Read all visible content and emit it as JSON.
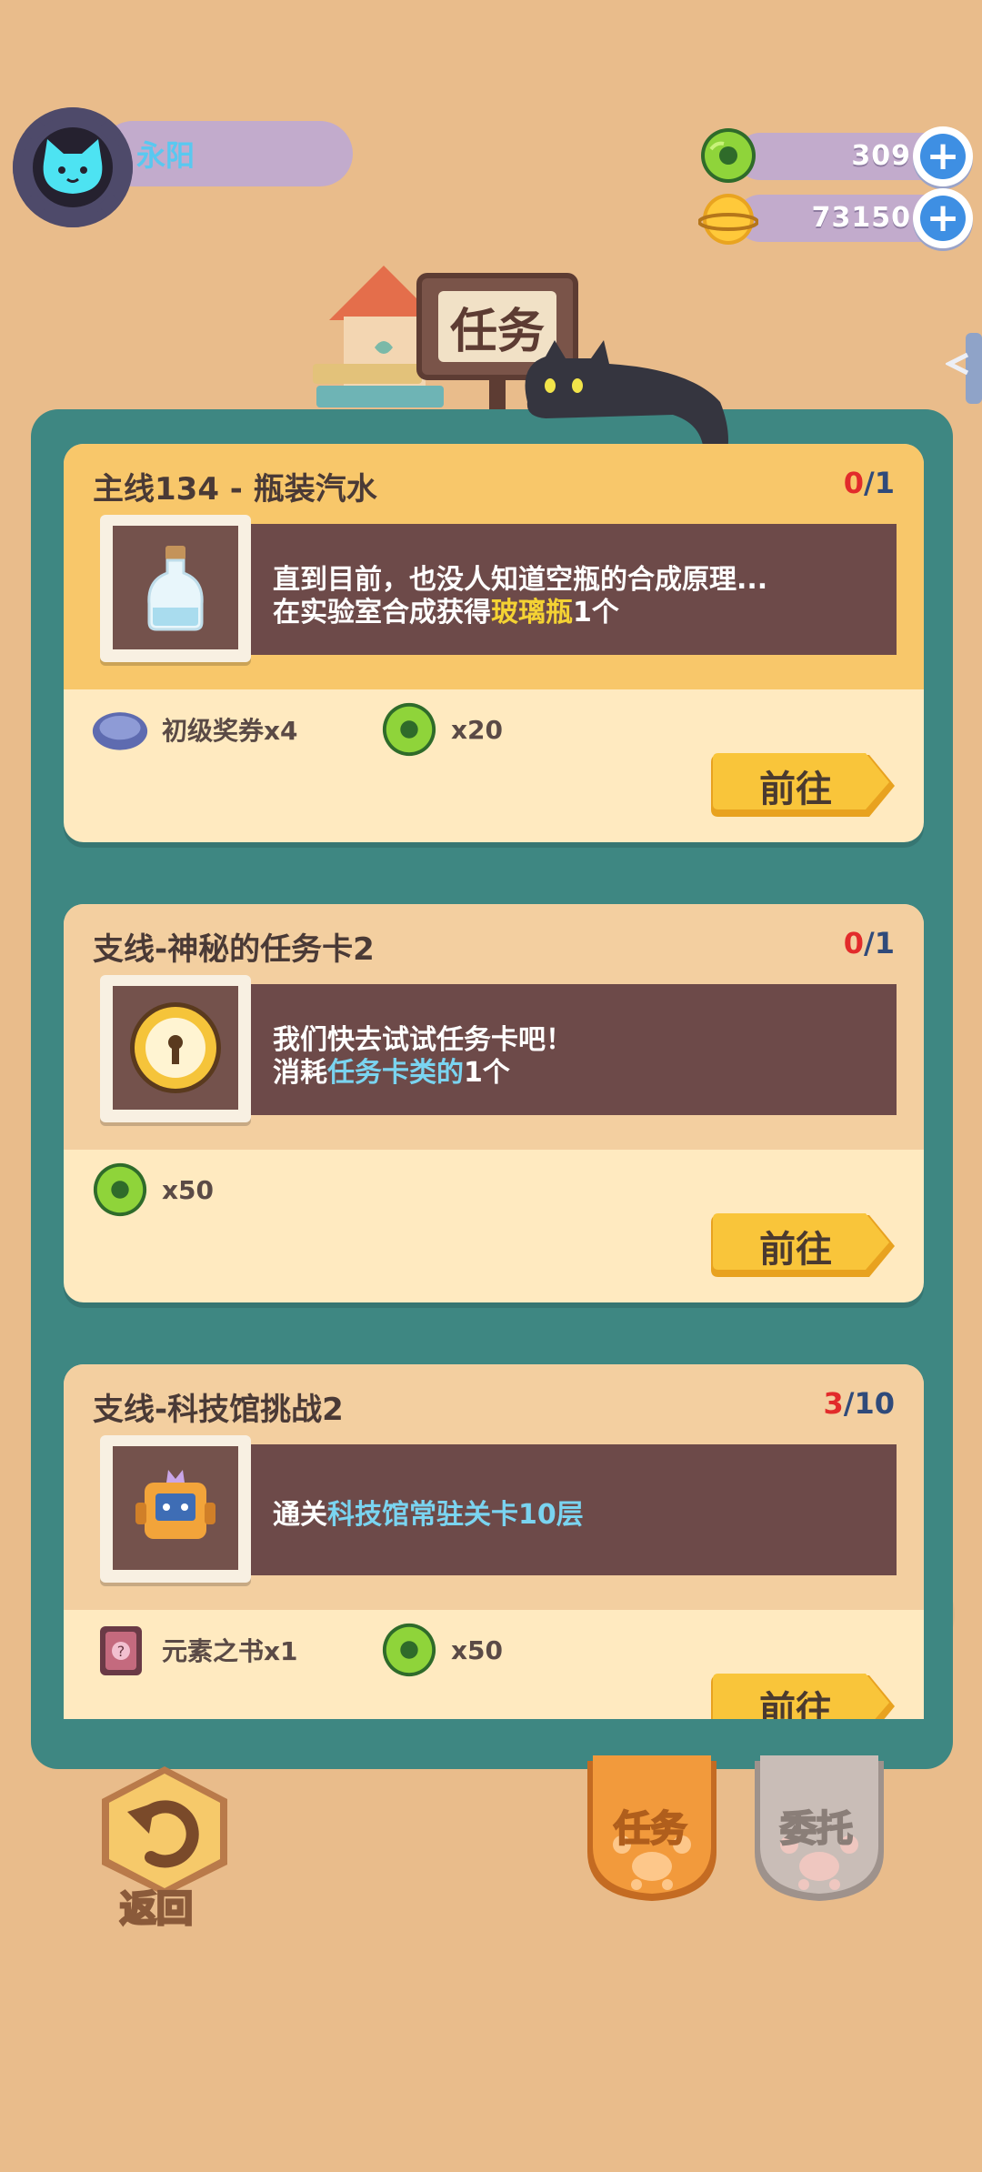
{
  "player": {
    "name": "永阳"
  },
  "resources": [
    {
      "icon": "green-donut-coin-icon",
      "value": "309"
    },
    {
      "icon": "gold-planet-coin-icon",
      "value": "73150"
    }
  ],
  "title_sign": "任务",
  "quests": [
    {
      "title": "主线134 - 瓶装汽水",
      "progress_current": "0",
      "progress_total": "/1",
      "thumb_icon": "glass-bottle-icon",
      "desc_line1": "直到目前，也没人知道空瓶的合成原理...",
      "desc_line2_pre": "在实验室合成获得",
      "desc_line2_hl": "玻璃瓶",
      "desc_line2_post": "1个",
      "rewards": [
        {
          "icon": "bottle-cap-voucher-icon",
          "label": "初级奖券x4"
        },
        {
          "icon": "green-donut-coin-icon",
          "label": "x20"
        }
      ],
      "button": "前往"
    },
    {
      "title": "支线-神秘的任务卡2",
      "progress_current": "0",
      "progress_total": "/1",
      "thumb_icon": "gold-clock-card-icon",
      "desc_line1": "我们快去试试任务卡吧！",
      "desc_line2_pre": "消耗",
      "desc_line2_hl": "任务卡类的",
      "desc_line2_post": "1个",
      "rewards": [
        {
          "icon": "green-donut-coin-icon",
          "label": "x50"
        }
      ],
      "button": "前往"
    },
    {
      "title": "支线-科技馆挑战2",
      "progress_current": "3",
      "progress_total": "/10",
      "thumb_icon": "robot-icon",
      "desc_single_pre": "通关",
      "desc_single_hl": "科技馆常驻关卡10层",
      "rewards": [
        {
          "icon": "element-book-icon",
          "label": "元素之书x1"
        },
        {
          "icon": "green-donut-coin-icon",
          "label": "x50"
        }
      ],
      "button": "前往"
    }
  ],
  "bottom": {
    "back_label": "返回",
    "tab_tasks": "任务",
    "tab_commission": "委托"
  },
  "colors": {
    "background": "#E9BC8B",
    "panel": "#3E8782",
    "card_body": "#FFEAC0",
    "main_header": "#F8C76A",
    "side_header": "#F3CFA0",
    "desc_box": "#6D4A49",
    "highlight_yellow": "#F4D233",
    "highlight_blue": "#7AD4F0",
    "go_button": "#F9C53A",
    "tab_tasks": "#F29A3C",
    "tab_commission": "#C9BDB7"
  }
}
